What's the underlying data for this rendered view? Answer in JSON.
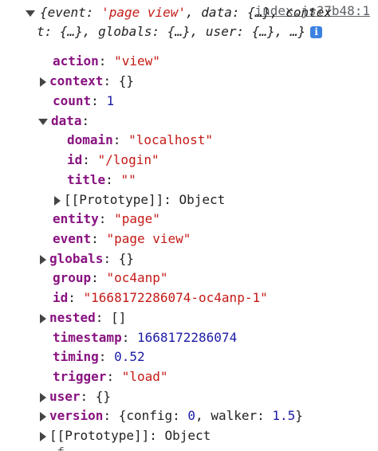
{
  "console": {
    "source_link": "index.js?7b48:1",
    "summary_line1_a": "{event: ",
    "summary_line1_event": "'page view'",
    "summary_line1_b": ", data: {…}, contex",
    "summary_line2": "t: {…}, globals: {…}, user: {…}, …}",
    "info_icon": "i",
    "properties": {
      "action": {
        "key": "action",
        "value": "\"view\""
      },
      "context": {
        "key": "context",
        "value": "{}"
      },
      "count": {
        "key": "count",
        "value": "1"
      },
      "data": {
        "key": "data",
        "domain": {
          "key": "domain",
          "value": "\"localhost\""
        },
        "id": {
          "key": "id",
          "value": "\"/login\""
        },
        "title": {
          "key": "title",
          "value": "\"\""
        },
        "prototype": {
          "key": "[[Prototype]]",
          "value": "Object"
        }
      },
      "entity": {
        "key": "entity",
        "value": "\"page\""
      },
      "event": {
        "key": "event",
        "value": "\"page view\""
      },
      "globals": {
        "key": "globals",
        "value": "{}"
      },
      "group": {
        "key": "group",
        "value": "\"oc4anp\""
      },
      "id": {
        "key": "id",
        "value": "\"1668172286074-oc4anp-1\""
      },
      "nested": {
        "key": "nested",
        "value": "[]"
      },
      "timestamp": {
        "key": "timestamp",
        "value": "1668172286074"
      },
      "timing": {
        "key": "timing",
        "value": "0.52"
      },
      "trigger": {
        "key": "trigger",
        "value": "\"load\""
      },
      "user": {
        "key": "user",
        "value": "{}"
      },
      "version": {
        "key": "version",
        "open": "{",
        "config_key": "config",
        "config_value": "0",
        "walker_key": "walker",
        "walker_value": "1.5",
        "close": "}"
      },
      "prototype": {
        "key": "[[Prototype]]",
        "value": "Object"
      }
    },
    "cutoff_text": "▸ f..."
  }
}
